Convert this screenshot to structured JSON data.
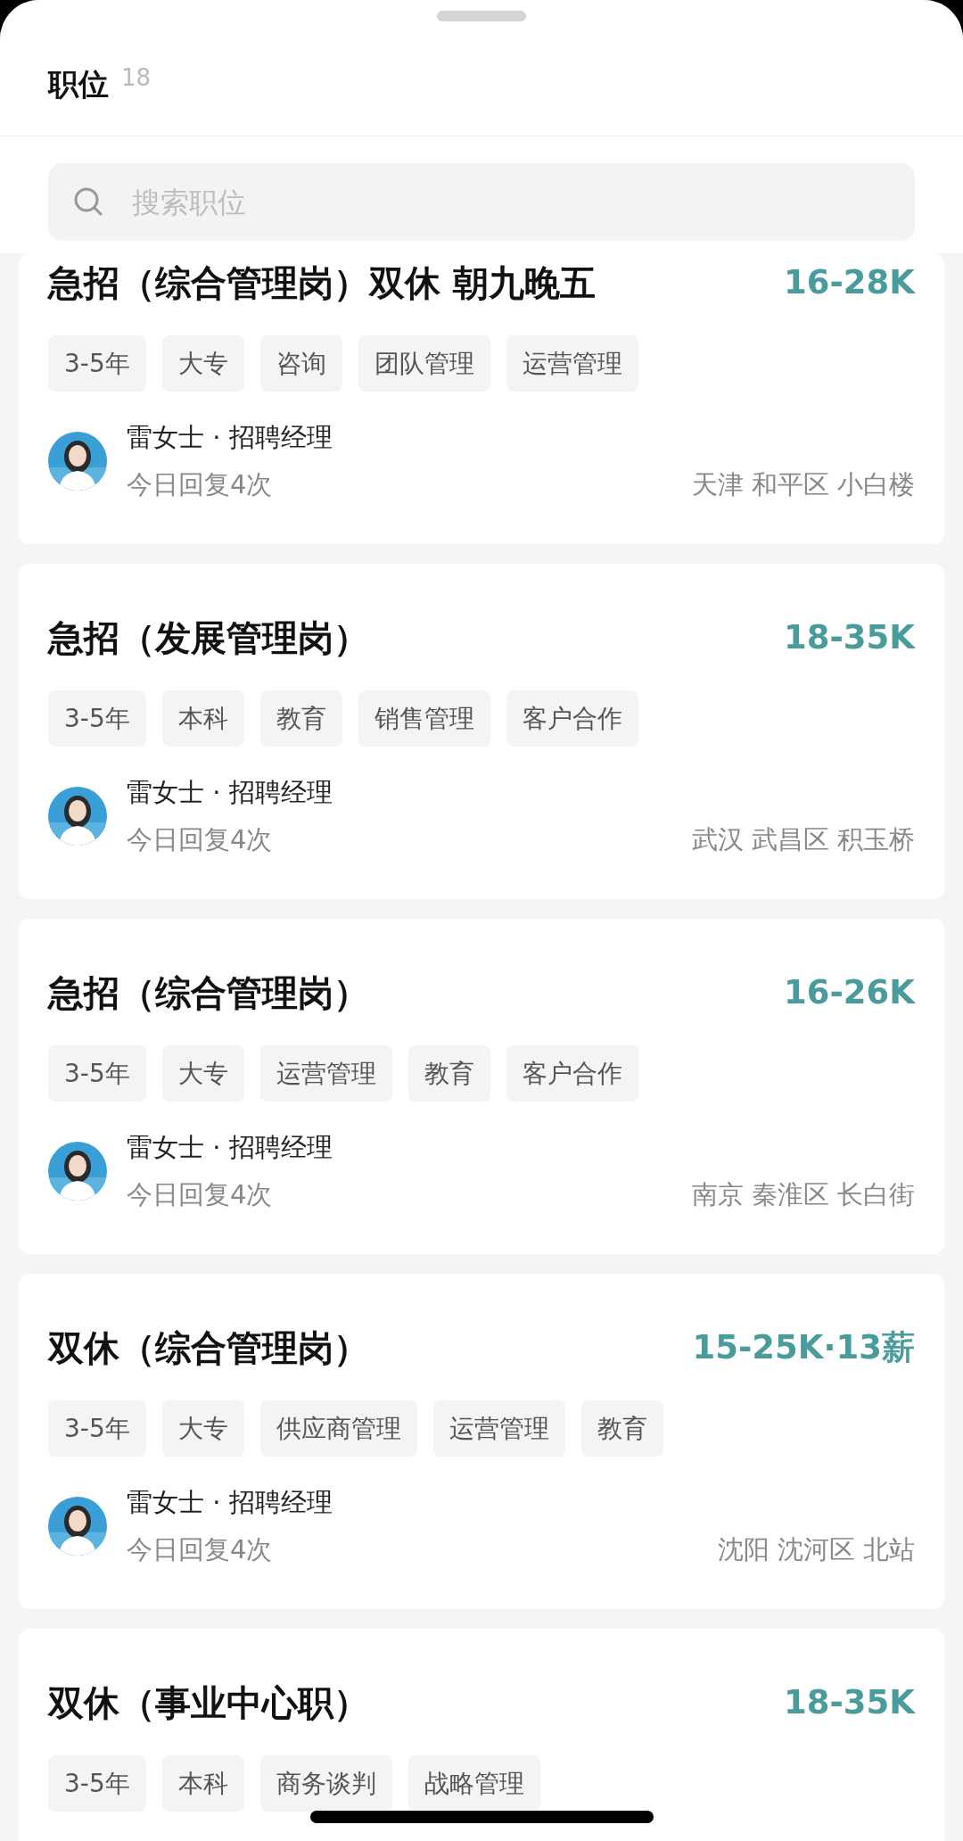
{
  "header": {
    "title": "职位",
    "count": "18"
  },
  "search": {
    "placeholder": "搜索职位"
  },
  "jobs": [
    {
      "title": "急招（综合管理岗）双休 朝九晚五",
      "salary": "16-28K",
      "tags": [
        "3-5年",
        "大专",
        "咨询",
        "团队管理",
        "运营管理"
      ],
      "recruiter": "雷女士 · 招聘经理",
      "reply": "今日回复4次",
      "location": "天津 和平区 小白楼"
    },
    {
      "title": "急招（发展管理岗）",
      "salary": "18-35K",
      "tags": [
        "3-5年",
        "本科",
        "教育",
        "销售管理",
        "客户合作"
      ],
      "recruiter": "雷女士 · 招聘经理",
      "reply": "今日回复4次",
      "location": "武汉 武昌区 积玉桥"
    },
    {
      "title": "急招（综合管理岗）",
      "salary": "16-26K",
      "tags": [
        "3-5年",
        "大专",
        "运营管理",
        "教育",
        "客户合作"
      ],
      "recruiter": "雷女士 · 招聘经理",
      "reply": "今日回复4次",
      "location": "南京 秦淮区 长白街"
    },
    {
      "title": "双休（综合管理岗）",
      "salary": "15-25K·13薪",
      "tags": [
        "3-5年",
        "大专",
        "供应商管理",
        "运营管理",
        "教育"
      ],
      "recruiter": "雷女士 · 招聘经理",
      "reply": "今日回复4次",
      "location": "沈阳 沈河区 北站"
    },
    {
      "title": "双休（事业中心职）",
      "salary": "18-35K",
      "tags": [
        "3-5年",
        "本科",
        "商务谈判",
        "战略管理"
      ]
    }
  ]
}
